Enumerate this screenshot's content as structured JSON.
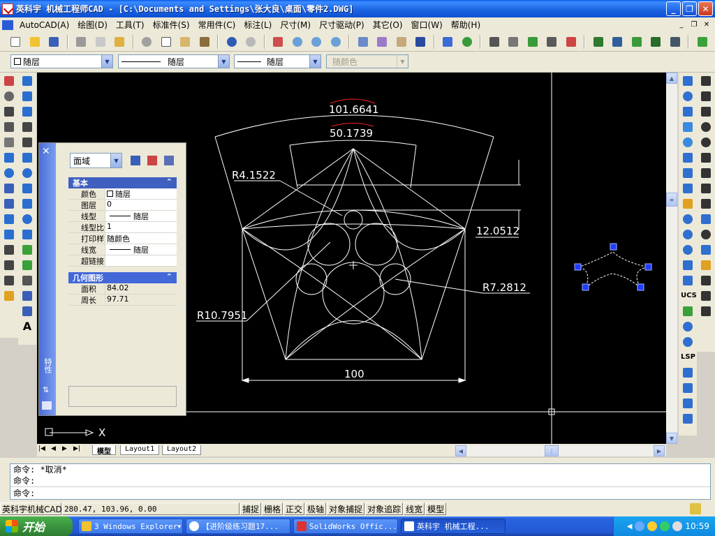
{
  "window": {
    "title": "英科宇 机械工程师CAD - [C:\\Documents and Settings\\张大良\\桌面\\零件2.DWG]"
  },
  "menu": {
    "items": [
      "AutoCAD(A)",
      "绘图(D)",
      "工具(T)",
      "标准件(S)",
      "常用件(C)",
      "标注(L)",
      "尺寸(M)",
      "尺寸驱动(P)",
      "其它(O)",
      "窗口(W)",
      "帮助(H)"
    ]
  },
  "layer_bar": {
    "layer": "随层",
    "linetype": "随层",
    "lineweight": "随层",
    "color": "随颜色"
  },
  "drawing": {
    "dimensions": {
      "outer_arc": "101.6641",
      "inner_arc": "50.1739",
      "r_small": "R4.1522",
      "vertical": "12.0512",
      "r_right": "R7.2812",
      "r_left": "R10.7951",
      "base": "100"
    },
    "ucs_x": "X"
  },
  "properties": {
    "selector": "面域",
    "strip_label": "特性",
    "sections": {
      "basic": "基本",
      "geometry": "几何图形"
    },
    "basic_rows": [
      {
        "key": "颜色",
        "value": "随层"
      },
      {
        "key": "图层",
        "value": "0"
      },
      {
        "key": "线型",
        "value": "随层"
      },
      {
        "key": "线型比例",
        "value": "1"
      },
      {
        "key": "打印样式",
        "value": "随颜色"
      },
      {
        "key": "线宽",
        "value": "随层"
      },
      {
        "key": "超链接",
        "value": ""
      }
    ],
    "geometry_rows": [
      {
        "key": "面积",
        "value": "84.02"
      },
      {
        "key": "周长",
        "value": "97.71"
      }
    ]
  },
  "tabs": [
    "模型",
    "Layout1",
    "Layout2"
  ],
  "command": {
    "lines": [
      "命令: *取消*",
      "命令:"
    ],
    "prompt": "命令:"
  },
  "status": {
    "app": "英科宇机械CAD",
    "coords": "280.47, 103.96, 0.00",
    "buttons": [
      "捕捉",
      "栅格",
      "正交",
      "极轴",
      "对象捕捉",
      "对象追踪",
      "线宽",
      "模型"
    ]
  },
  "taskbar": {
    "start": "开始",
    "tasks": [
      "3 Windows Explorer",
      "【进阶级练习题17...",
      "SolidWorks Offic...",
      "英科宇 机械工程..."
    ],
    "clock": "10:59"
  },
  "side_labels": {
    "ucs": "UCS",
    "lsp": "LSP",
    "text_a": "A"
  },
  "colors": {
    "titlebar": "#0c4fd2",
    "canvas": "#000000",
    "grip": "#1f3cff",
    "arc_dim": "#ff2020"
  }
}
